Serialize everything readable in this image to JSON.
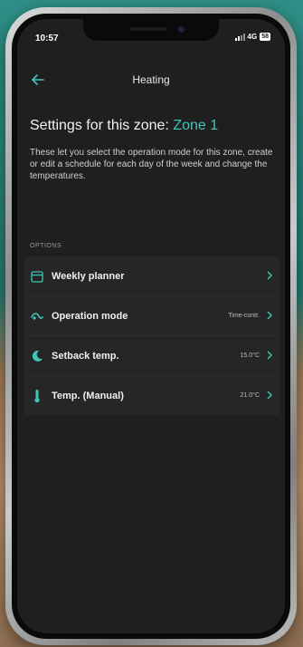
{
  "status_bar": {
    "time": "10:57",
    "network": "4G",
    "battery": "58"
  },
  "header": {
    "title": "Heating"
  },
  "zone_heading": {
    "prefix": "Settings for this zone: ",
    "zone_name": "Zone 1"
  },
  "description": "These let you select the operation mode for this zone, create or edit a schedule for each day of the week and change the temperatures.",
  "section_label": "OPTIONS",
  "options": [
    {
      "label": "Weekly planner",
      "value": "",
      "icon": "calendar-icon"
    },
    {
      "label": "Operation mode",
      "value": "Time-contr.",
      "icon": "mode-icon"
    },
    {
      "label": "Setback temp.",
      "value": "15.0°C",
      "icon": "moon-icon"
    },
    {
      "label": "Temp. (Manual)",
      "value": "21.0°C",
      "icon": "thermometer-icon"
    }
  ],
  "colors": {
    "accent": "#3fc6b6",
    "background": "#1f1f1f",
    "row": "#262626"
  }
}
